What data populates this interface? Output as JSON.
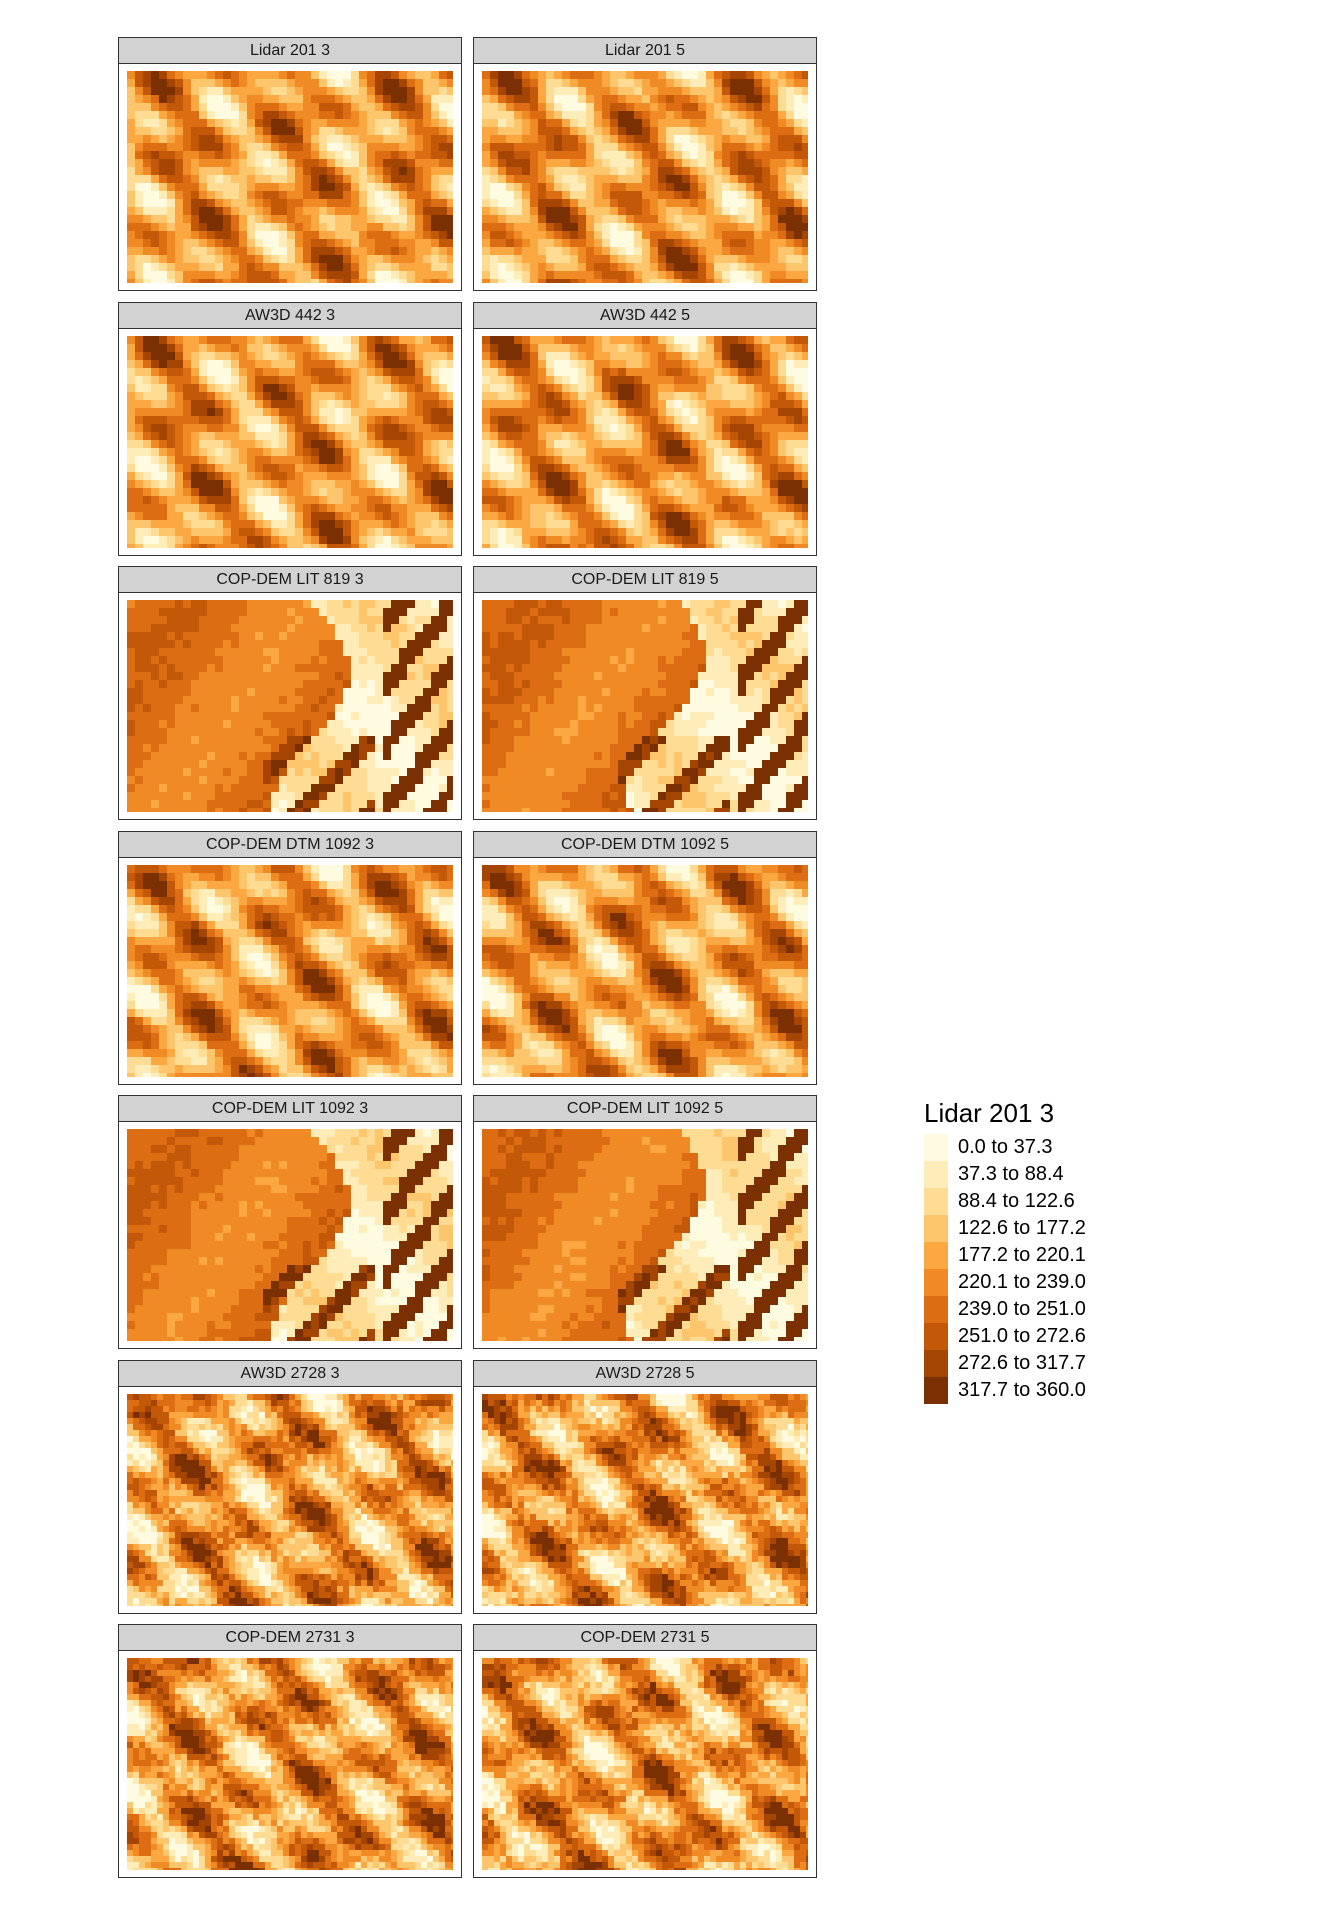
{
  "panels": [
    {
      "title": "Lidar 201 3",
      "pattern": "ridged"
    },
    {
      "title": "Lidar 201 5",
      "pattern": "ridged"
    },
    {
      "title": "AW3D 442 3",
      "pattern": "ridged"
    },
    {
      "title": "AW3D 442 5",
      "pattern": "ridged"
    },
    {
      "title": "COP-DEM LIT 819 3",
      "pattern": "smooth"
    },
    {
      "title": "COP-DEM LIT 819 5",
      "pattern": "smooth"
    },
    {
      "title": "COP-DEM DTM 1092 3",
      "pattern": "ridged"
    },
    {
      "title": "COP-DEM DTM 1092 5",
      "pattern": "ridged"
    },
    {
      "title": "COP-DEM LIT 1092 3",
      "pattern": "smooth"
    },
    {
      "title": "COP-DEM LIT 1092 5",
      "pattern": "smooth"
    },
    {
      "title": "AW3D 2728 3",
      "pattern": "noisy"
    },
    {
      "title": "AW3D 2728 5",
      "pattern": "noisy"
    },
    {
      "title": "COP-DEM 2731 3",
      "pattern": "noisy"
    },
    {
      "title": "COP-DEM 2731 5",
      "pattern": "noisy"
    }
  ],
  "legend": {
    "title": "Lidar 201 3",
    "classes": [
      {
        "label": "0.0 to 37.3",
        "color": "#fffbe0"
      },
      {
        "label": "37.3 to 88.4",
        "color": "#feedb8"
      },
      {
        "label": "88.4 to 122.6",
        "color": "#fedc94"
      },
      {
        "label": "122.6 to 177.2",
        "color": "#fdc56c"
      },
      {
        "label": "177.2 to 220.1",
        "color": "#fba843"
      },
      {
        "label": "220.1 to 239.0",
        "color": "#f08a24"
      },
      {
        "label": "239.0 to 251.0",
        "color": "#dc6d12"
      },
      {
        "label": "251.0 to 272.6",
        "color": "#c35808"
      },
      {
        "label": "272.6 to 317.7",
        "color": "#a44504"
      },
      {
        "label": "317.7 to 360.0",
        "color": "#7a3003"
      }
    ]
  }
}
